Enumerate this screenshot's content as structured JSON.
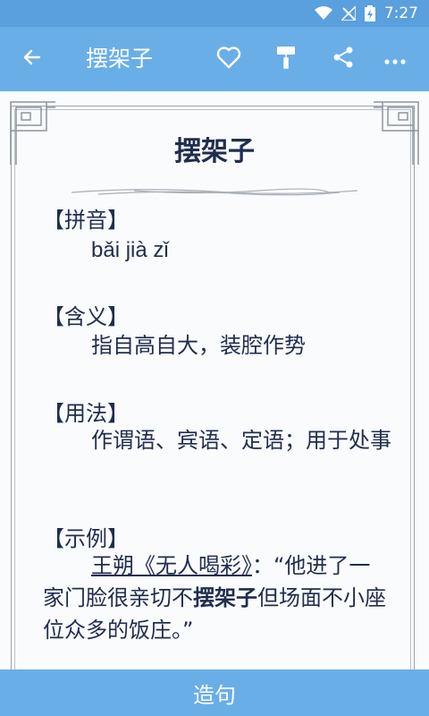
{
  "status_bar": {
    "time": "7:27"
  },
  "app_bar": {
    "title": "摆架子",
    "icons": [
      "back-arrow-icon",
      "heart-icon",
      "paint-roller-icon",
      "share-icon",
      "more-icon"
    ]
  },
  "entry": {
    "word": "摆架子",
    "sections": [
      {
        "heading": "【拼音】",
        "body": "bǎi jià zǐ"
      },
      {
        "heading": "【含义】",
        "body": "指自高自大，装腔作势"
      },
      {
        "heading": "【用法】",
        "body": "作谓语、宾语、定语；用于处事"
      },
      {
        "heading": "【示例】",
        "source_author": "王朔",
        "source_title": "《无人喝彩》",
        "quote_before": "：“他进了一家门脸很亲切不",
        "quote_bold": "摆架子",
        "quote_after": "但场面不小座位众多的饭庄。”"
      }
    ]
  },
  "bottom_bar": {
    "label": "造句"
  }
}
